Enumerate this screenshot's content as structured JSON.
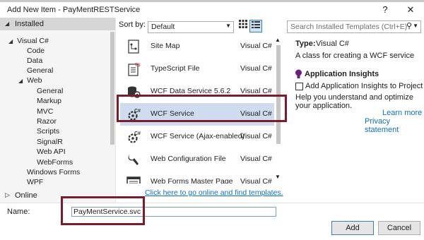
{
  "window": {
    "title": "Add New Item - PayMentRESTService",
    "help_label": "?",
    "close_label": "✕"
  },
  "tree": {
    "installed_label": "Installed",
    "visual_csharp": "Visual C#",
    "children": [
      "Code",
      "Data",
      "General"
    ],
    "web_label": "Web",
    "web_children": [
      "General",
      "Markup",
      "MVC",
      "Razor",
      "Scripts",
      "SignalR",
      "Web API",
      "WebForms"
    ],
    "after_web": [
      "Windows Forms",
      "WPF"
    ],
    "online_label": "Online"
  },
  "sort": {
    "label": "Sort by:",
    "value": "Default"
  },
  "templates": [
    {
      "name": "Site Map",
      "lang": "Visual C#",
      "icon": "site-map-icon"
    },
    {
      "name": "TypeScript File",
      "lang": "Visual C#",
      "icon": "typescript-file-icon"
    },
    {
      "name": "WCF Data Service 5.6.2",
      "lang": "Visual C#",
      "icon": "wcf-data-service-icon"
    },
    {
      "name": "WCF Service",
      "lang": "Visual C#",
      "icon": "wcf-service-icon",
      "selected": true
    },
    {
      "name": "WCF Service (Ajax-enabled)",
      "lang": "Visual C#",
      "icon": "wcf-ajax-service-icon"
    },
    {
      "name": "Web Configuration File",
      "lang": "Visual C#",
      "icon": "web-config-icon"
    },
    {
      "name": "Web Forms Master Page",
      "lang": "Visual C#",
      "icon": "master-page-icon"
    }
  ],
  "online_link": "Click here to go online and find templates.",
  "search": {
    "placeholder": "Search Installed Templates (Ctrl+E)"
  },
  "details": {
    "type_label": "Type:",
    "type_value": "Visual C#",
    "description": "A class for creating a WCF service",
    "insights_title": "Application Insights",
    "insights_checkbox": "Add Application Insights to Project",
    "insights_desc": "Help you understand and optimize your application.",
    "learn_more": "Learn more",
    "privacy": "Privacy statement"
  },
  "name_field": {
    "label": "Name:",
    "value": "PayMentService.svc"
  },
  "buttons": {
    "add": "Add",
    "cancel": "Cancel"
  },
  "colors": {
    "highlight_box": "#7a1c2b",
    "selected_row": "#cfdcef",
    "link": "#0e70c0"
  }
}
